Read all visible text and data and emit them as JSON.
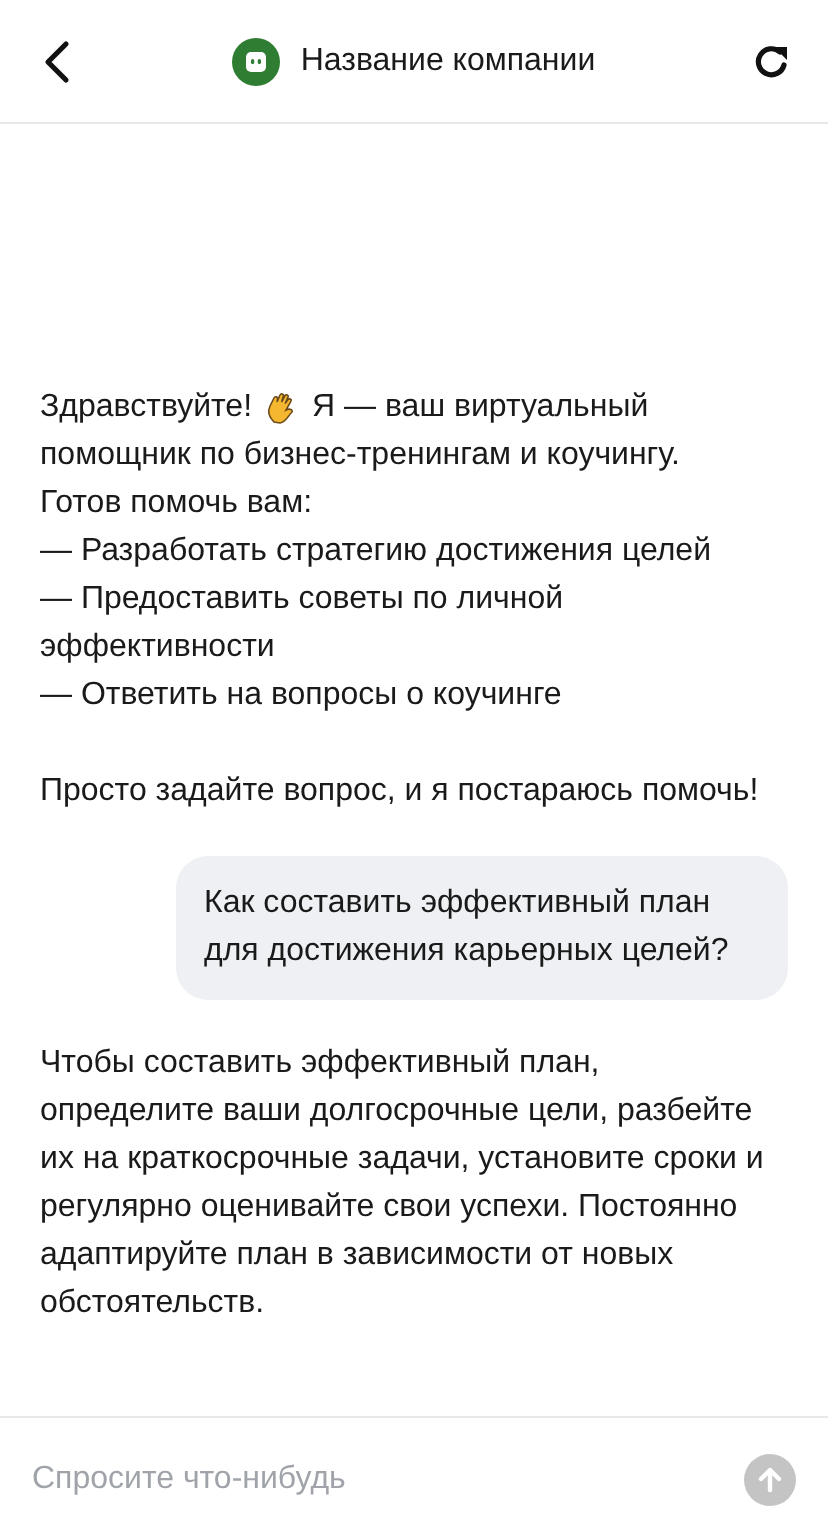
{
  "header": {
    "title": "Название компании"
  },
  "messages": [
    {
      "kind": "bot",
      "greeting": {
        "before": "Здравствуйте!",
        "after": "Я — ваш виртуальный"
      },
      "lines": [
        "помощник по бизнес-тренингам и коучингу.",
        "Готов помочь вам:",
        "— Разработать стратегию достижения целей",
        "— Предоставить советы по личной эффективности",
        "— Ответить на вопросы о коучинге"
      ],
      "closing": "Просто задайте вопрос, и я постараюсь помочь!"
    },
    {
      "kind": "user",
      "text": "Как составить эффективный план для достижения карьерных целей?"
    },
    {
      "kind": "bot",
      "text": "Чтобы составить эффективный план, определите ваши долгосрочные цели, разбейте их на краткосрочные задачи, установите сроки и регулярно оценивайте свои успехи. Постоянно адаптируйте план в зависимости от новых обстоятельств."
    }
  ],
  "composer": {
    "placeholder": "Спросите что-нибудь",
    "send_disabled": true
  }
}
